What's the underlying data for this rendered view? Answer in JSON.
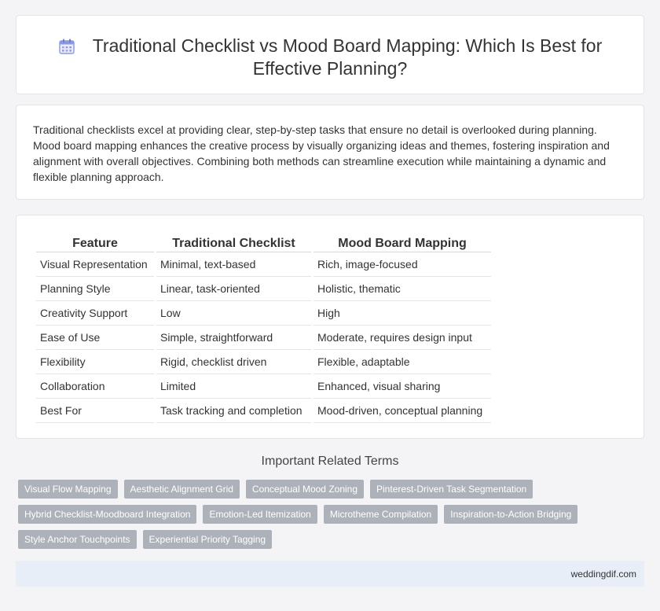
{
  "header": {
    "title": "Traditional Checklist vs Mood Board Mapping: Which Is Best for Effective Planning?",
    "icon": "calendar-icon"
  },
  "summary": {
    "text": "Traditional checklists excel at providing clear, step-by-step tasks that ensure no detail is overlooked during planning. Mood board mapping enhances the creative process by visually organizing ideas and themes, fostering inspiration and alignment with overall objectives. Combining both methods can streamline execution while maintaining a dynamic and flexible planning approach."
  },
  "table": {
    "headers": [
      "Feature",
      "Traditional Checklist",
      "Mood Board Mapping"
    ],
    "rows": [
      [
        "Visual Representation",
        "Minimal, text-based",
        "Rich, image-focused"
      ],
      [
        "Planning Style",
        "Linear, task-oriented",
        "Holistic, thematic"
      ],
      [
        "Creativity Support",
        "Low",
        "High"
      ],
      [
        "Ease of Use",
        "Simple, straightforward",
        "Moderate, requires design input"
      ],
      [
        "Flexibility",
        "Rigid, checklist driven",
        "Flexible, adaptable"
      ],
      [
        "Collaboration",
        "Limited",
        "Enhanced, visual sharing"
      ],
      [
        "Best For",
        "Task tracking and completion",
        "Mood-driven, conceptual planning"
      ]
    ]
  },
  "related": {
    "title": "Important Related Terms",
    "tags": [
      "Visual Flow Mapping",
      "Aesthetic Alignment Grid",
      "Conceptual Mood Zoning",
      "Pinterest-Driven Task Segmentation",
      "Hybrid Checklist-Moodboard Integration",
      "Emotion-Led Itemization",
      "Microtheme Compilation",
      "Inspiration-to-Action Bridging",
      "Style Anchor Touchpoints",
      "Experiential Priority Tagging"
    ]
  },
  "footer": {
    "site": "weddingdif.com"
  },
  "colors": {
    "tag_bg": "#adb1b9",
    "footer_bg": "#e8eef8",
    "icon_accent": "#7b8fd8"
  }
}
